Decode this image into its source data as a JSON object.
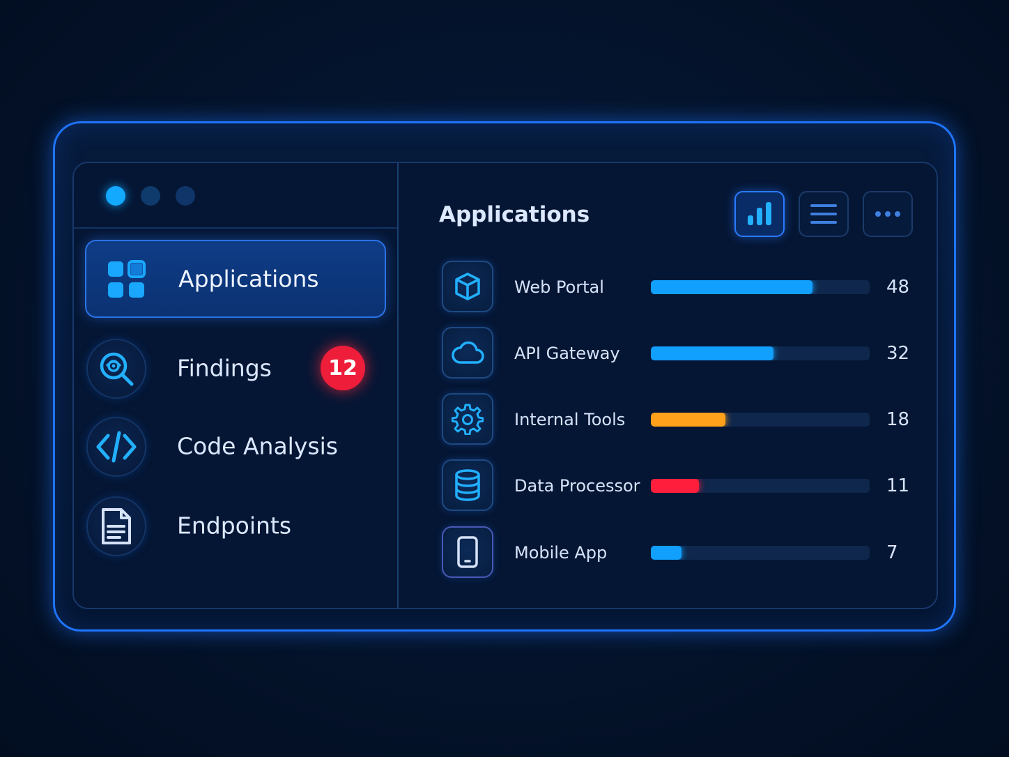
{
  "colors": {
    "accent": "#1f74ff",
    "dot_active": "#12a9ff",
    "dot_inactive": "#0f3a6c",
    "badge_red": "#ee1d3a",
    "bar_blue": "#12a0ff",
    "bar_orange": "#ffa11a",
    "bar_red": "#ff1f3c"
  },
  "sidebar": {
    "items": [
      {
        "label": "Applications",
        "icon": "grid-icon",
        "active": true
      },
      {
        "label": "Findings",
        "icon": "search-scan-icon",
        "badge": "12"
      },
      {
        "label": "Code Analysis",
        "icon": "code-icon"
      },
      {
        "label": "Endpoints",
        "icon": "document-icon"
      }
    ]
  },
  "main": {
    "title": "Applications",
    "view_buttons": [
      {
        "icon": "bar-chart-icon",
        "active": true
      },
      {
        "icon": "list-icon"
      },
      {
        "icon": "more-icon"
      }
    ],
    "apps": [
      {
        "name": "Web Portal",
        "count": "48",
        "icon": "cube-icon",
        "fill": 0.74,
        "color": "#12a0ff"
      },
      {
        "name": "API Gateway",
        "count": "32",
        "icon": "cloud-icon",
        "fill": 0.56,
        "color": "#12a0ff"
      },
      {
        "name": "Internal Tools",
        "count": "18",
        "icon": "gear-icon",
        "fill": 0.34,
        "color": "#ffa11a"
      },
      {
        "name": "Data Processor",
        "count": "11",
        "icon": "database-icon",
        "fill": 0.22,
        "color": "#ff1f3c"
      },
      {
        "name": "Mobile App",
        "count": "7",
        "icon": "mobile-icon",
        "fill": 0.14,
        "color": "#12a0ff"
      }
    ]
  }
}
